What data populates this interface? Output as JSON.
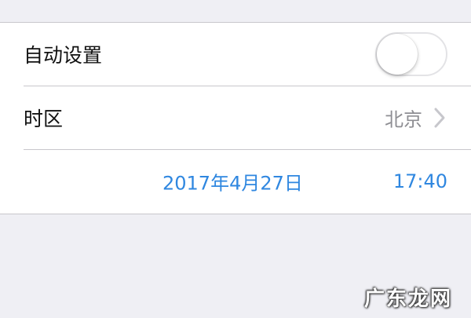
{
  "settings": {
    "auto_set": {
      "label": "自动设置",
      "toggle_on": false
    },
    "time_zone": {
      "label": "时区",
      "value": "北京",
      "chevron_icon": "chevron-right-icon"
    },
    "date_time": {
      "date": "2017年4月27日",
      "time": "17:40"
    }
  },
  "watermark": {
    "text": "广东龙网"
  },
  "colors": {
    "background": "#efeff4",
    "cell": "#ffffff",
    "separator": "#c8c7cc",
    "accent": "#2f87e0",
    "secondary_text": "#8e8e93"
  }
}
